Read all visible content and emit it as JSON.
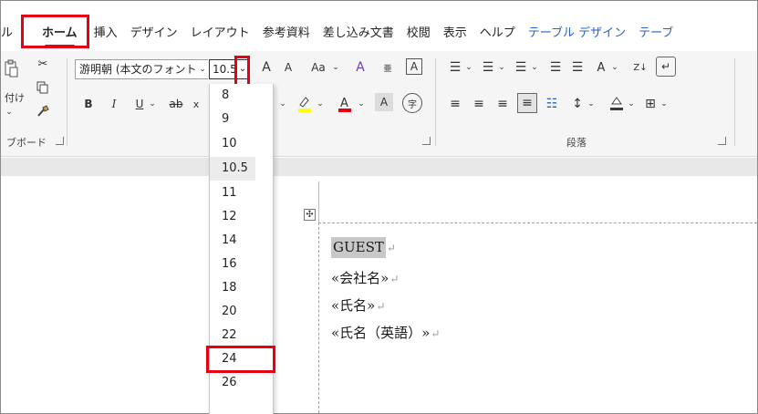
{
  "tabs": [
    {
      "label": "ル"
    },
    {
      "label": "ホーム"
    },
    {
      "label": "挿入"
    },
    {
      "label": "デザイン"
    },
    {
      "label": "レイアウト"
    },
    {
      "label": "参考資料"
    },
    {
      "label": "差し込み文書"
    },
    {
      "label": "校閲"
    },
    {
      "label": "表示"
    },
    {
      "label": "ヘルプ"
    },
    {
      "label": "テーブル デザイン"
    },
    {
      "label": "テーブ"
    }
  ],
  "ribbon": {
    "clipboard": {
      "paste_label": "付け",
      "group_label": "ブボード"
    },
    "font": {
      "font_name": "游明朝 (本文のフォント",
      "font_size": "10.5",
      "grow_label": "A",
      "shrink_label": "A",
      "case_label": "Aa",
      "bold": "B",
      "italic": "I",
      "underline": "U",
      "strike": "ab",
      "ruby": "亜",
      "border_char": "A",
      "char_shade": "A",
      "enclose": "字"
    },
    "paragraph": {
      "group_label": "段落",
      "sort_label": "Z↓"
    },
    "accent_color": "#e60012",
    "font_color_bar": "#e60012",
    "highlight_bar": "#ffff00"
  },
  "font_size_dropdown": {
    "items": [
      "8",
      "9",
      "10",
      "10.5",
      "11",
      "12",
      "14",
      "16",
      "18",
      "20",
      "22",
      "24",
      "26"
    ],
    "current": "10.5",
    "highlighted": "24"
  },
  "document": {
    "lines": [
      {
        "text": "GUEST",
        "selected": true
      },
      {
        "text": "«会社名»",
        "selected": false
      },
      {
        "text": "«氏名»",
        "selected": false
      },
      {
        "text": "«氏名（英語）»",
        "selected": false
      }
    ]
  }
}
